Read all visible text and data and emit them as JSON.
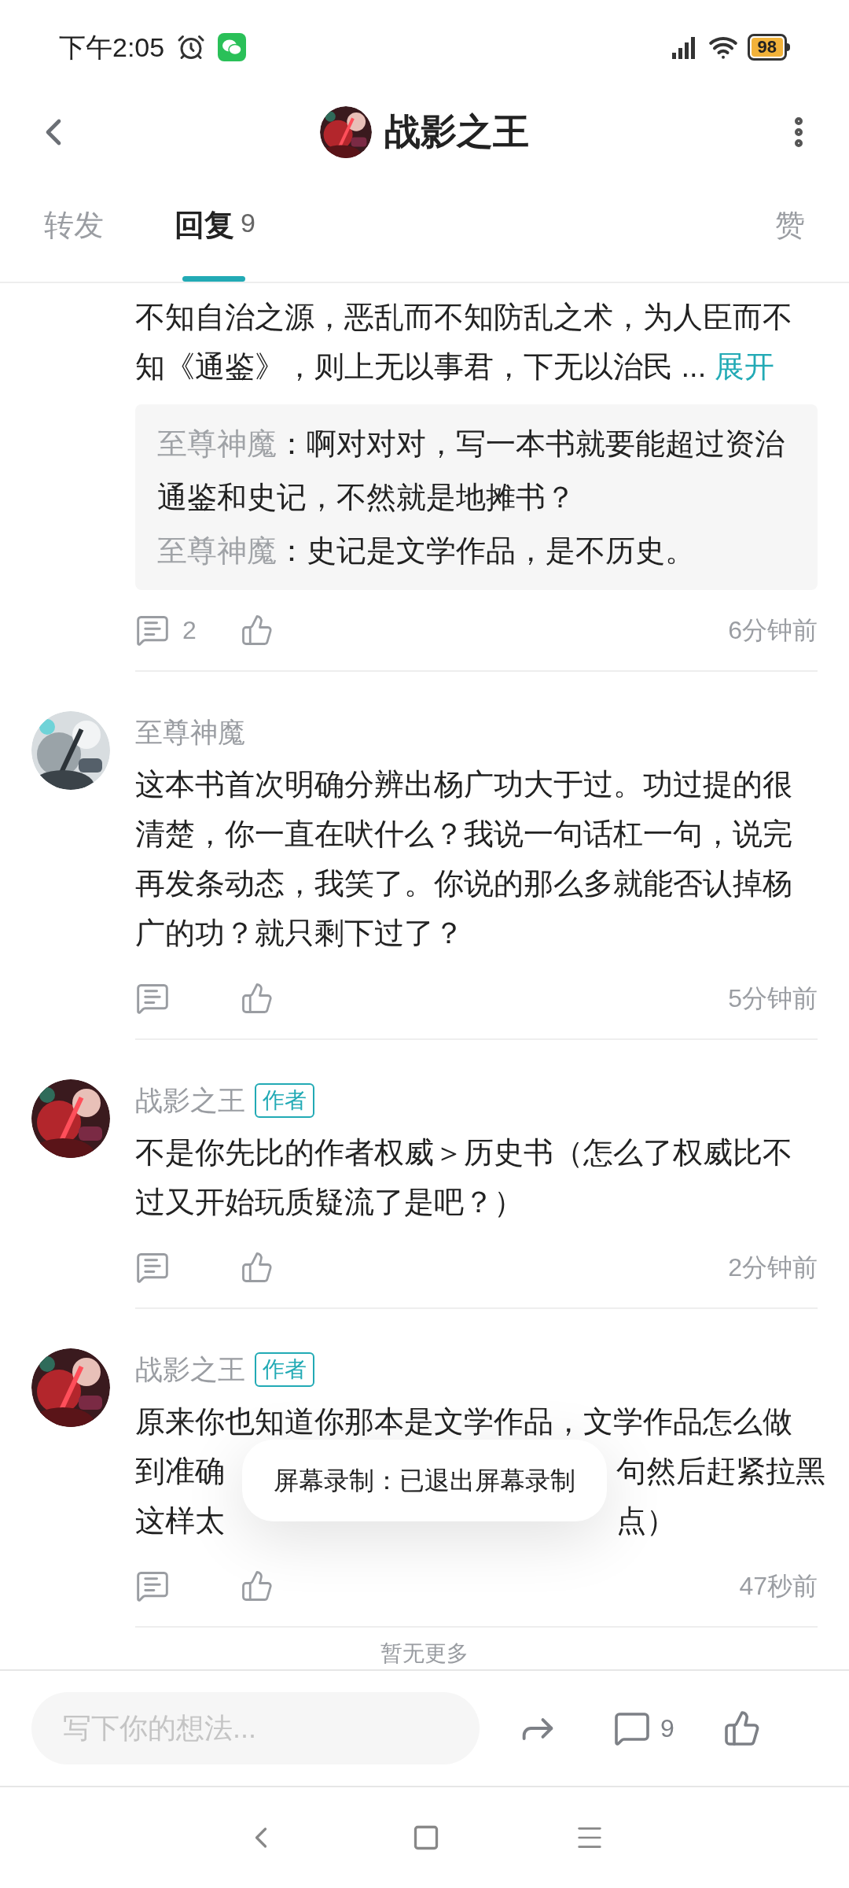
{
  "status_bar": {
    "time": "下午2:05",
    "battery": "98"
  },
  "header": {
    "title": "战影之王"
  },
  "tabs": [
    {
      "label": "转发",
      "selected": false
    },
    {
      "label": "回复",
      "count": "9",
      "selected": true
    },
    {
      "label": "赞",
      "selected": false
    }
  ],
  "comments": [
    {
      "text": "不知自治之源，恶乱而不知防乱之术，为人臣而不知《通鉴》，则上无以事君，下无以治民 ...",
      "more_link": "展开",
      "replies": [
        {
          "author": "至尊神魔",
          "text": "：啊对对对，写一本书就要能超过资治通鉴和史记，不然就是地摊书？"
        },
        {
          "author": "至尊神魔",
          "text": "：史记是文学作品，是不历史。"
        }
      ],
      "reply_count": "2",
      "time": "6分钟前"
    },
    {
      "author": "至尊神魔",
      "text": "这本书首次明确分辨出杨广功大于过。功过提的很清楚，你一直在吠什么？我说一句话杠一句，说完再发条动态，我笑了。你说的那么多就能否认掉杨广的功？就只剩下过了？",
      "time": "5分钟前"
    },
    {
      "author": "战影之王",
      "author_badge": "作者",
      "text": "不是你先比的作者权威＞历史书（怎么了权威比不过又开始玩质疑流了是吧？）",
      "time": "2分钟前"
    },
    {
      "author": "战影之王",
      "author_badge": "作者",
      "text_lines": [
        {
          "left": "原来你也知道你那本是文学作品，文学作品怎么做"
        },
        {
          "left": "到准确",
          "right": "句然后赶紧拉黑"
        },
        {
          "left": "这样太",
          "right": "点）"
        }
      ],
      "time": "47秒前"
    }
  ],
  "end_note": "暂无更多",
  "toast": "屏幕录制：已退出屏幕录制",
  "bottom_bar": {
    "placeholder": "写下你的想法...",
    "comment_count": "9"
  }
}
